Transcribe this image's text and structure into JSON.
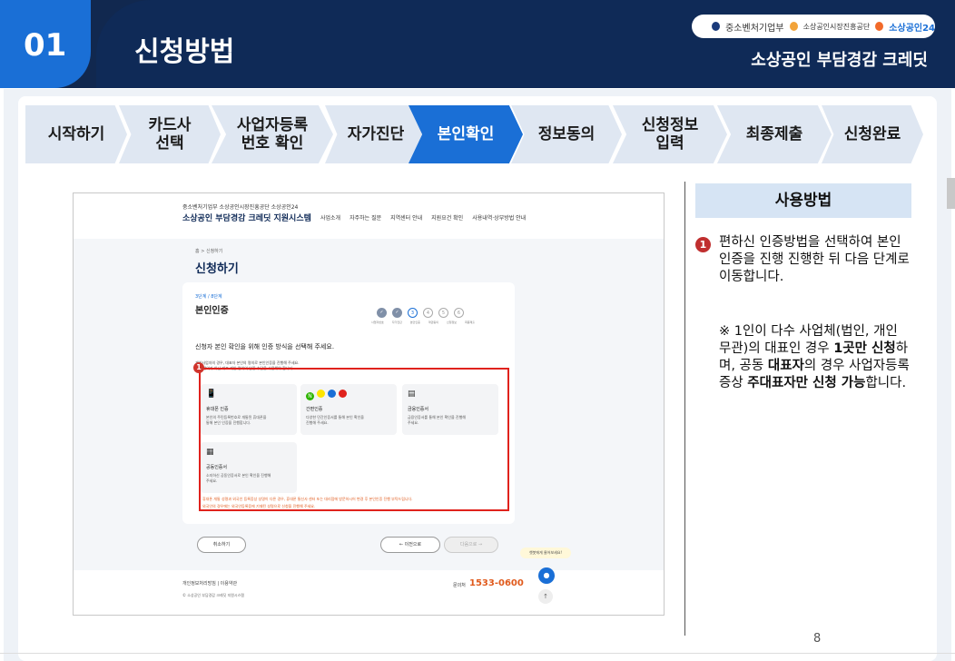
{
  "header": {
    "number": "01",
    "title": "신청방법",
    "subtitle": "소상공인 부담경감 크레딧",
    "logos": [
      "중소벤처기업부",
      "소상공인시장진흥공단",
      "소상공인24"
    ]
  },
  "steps": [
    {
      "label": "시작하기",
      "active": false
    },
    {
      "label": "카드사\n선택",
      "active": false
    },
    {
      "label": "사업자등록\n번호 확인",
      "active": false
    },
    {
      "label": "자가진단",
      "active": false
    },
    {
      "label": "본인확인",
      "active": true
    },
    {
      "label": "정보동의",
      "active": false
    },
    {
      "label": "신청정보\n입력",
      "active": false
    },
    {
      "label": "최종제출",
      "active": false
    },
    {
      "label": "신청완료",
      "active": false
    }
  ],
  "screenshot": {
    "logos": "중소벤처기업부  소상공인시장진흥공단  소상공인24",
    "brand": "소상공인 부담경감 크레딧 지원시스템",
    "nav": [
      "사업소개",
      "자주하는 질문",
      "지역센터 안내",
      "지원요건 확인",
      "사용내역·상부방법 안내"
    ],
    "breadcrumb": "홈 > 신청하기",
    "page_title": "신청하기",
    "step_label": "3단계 / 8단계",
    "step_name": "본인인증",
    "progress": [
      "",
      "",
      "3",
      "4",
      "5",
      "6"
    ],
    "progress_labels": [
      "사업자번호",
      "자가진단",
      "본인인증",
      "약관동의",
      "신청정보",
      "최종제출"
    ],
    "desc": "신청자 본인 확인을 위해 인증 방식을 선택해 주세요.",
    "note1": "개인사업자의 경우, 대표자 본인의 명의로 본인인증을 진행해 주세요.",
    "note2": "대표 명의가 아닌 대표 개인 명의의 인증 수단을 사용해야 합니다.",
    "options": [
      {
        "icon": "📱",
        "name": "휴대폰 인증",
        "desc": "본인의 주민등록번호로 개통된 휴대폰을\n통해 본인 인증을 진행합니다."
      },
      {
        "icon": "N",
        "name": "간편인증",
        "desc": "다양한 민간인증서를 통해 본인 확인을\n진행해 주세요."
      },
      {
        "icon": "▤",
        "name": "금융인증서",
        "desc": "금융인증서를 통해 본인 확인을 진행해\n주세요."
      },
      {
        "icon": "▦",
        "name": "공동인증서",
        "desc": "소지하신 공동인증서로 본인 확인을 진행해\n주세요."
      }
    ],
    "warn1": "휴대폰 개통 성명과 외국인 등록증상 성명이 다른 경우, 휴대폰 통신사 센터 또는 대리점에 방문하시어 변경 후 본인인증 진행 부탁드립니다.",
    "warn2": "외국인의 경우에는 외국인등록증에 기재된 성명으로 신청을 진행해 주세요.",
    "badge": "1",
    "cancel": "취소하기",
    "prev": "← 이전으로",
    "next": "다음으로 →",
    "chat_tip": "챗봇에게 물어보세요!",
    "footer1": "개인정보처리방침  |  이용약관",
    "footer2": "© 소상공인 부담경감 크레딧 지원시스템",
    "phone_label": "문의처",
    "phone": "1533-0600"
  },
  "usage": {
    "heading": "사용방법",
    "num": "1",
    "text": "편하신 인증방법을 선택하여 본인인증을 진행 진행한 뒤 다음 단계로 이동합니다.",
    "note_a": "※ 1인이 다수 사업체(법인, 개인 무관)의 대표인 경우 ",
    "note_b": "1곳만 신청",
    "note_c": "하며, 공동 ",
    "note_d": "대표자",
    "note_e": "의 경우 사업자등록증상 ",
    "note_f": "주대표자만 신청 가능",
    "note_g": "합니다."
  },
  "page_number": "8",
  "colors": {
    "navy": "#0f2a57",
    "blue": "#1a6fd6",
    "red": "#e0221d"
  }
}
